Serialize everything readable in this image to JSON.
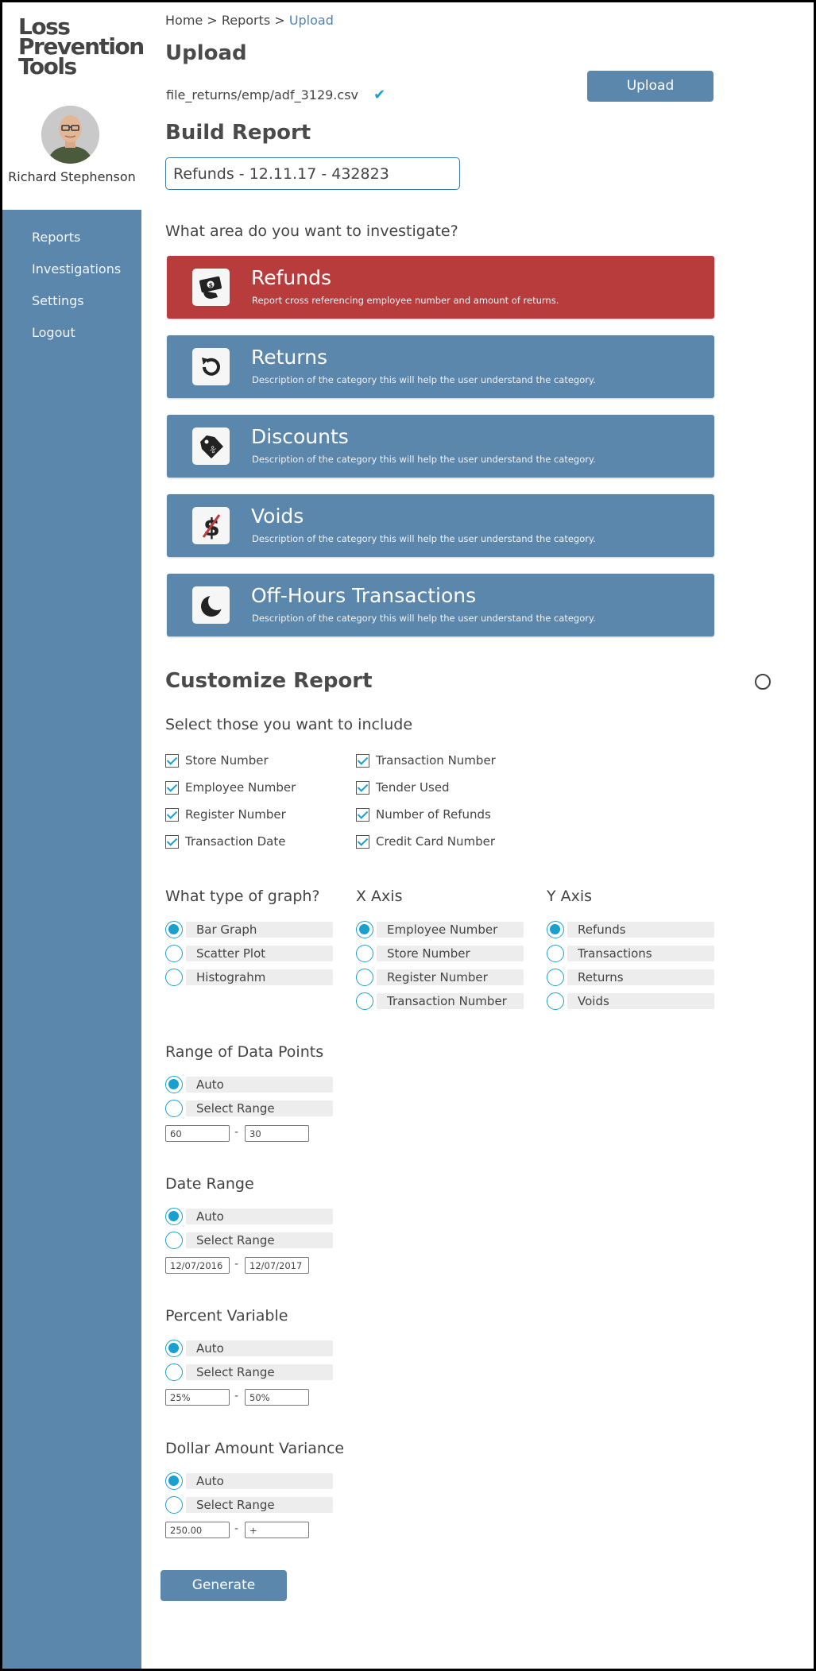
{
  "brand": {
    "logo_lines": [
      "Loss",
      "Prevention",
      "Tools"
    ]
  },
  "user": {
    "name": "Richard Stephenson"
  },
  "nav": {
    "items": [
      "Reports",
      "Investigations",
      "Settings",
      "Logout"
    ]
  },
  "breadcrumb": {
    "items": [
      "Home",
      "Reports"
    ],
    "separator": ">",
    "current": "Upload"
  },
  "upload": {
    "title": "Upload",
    "file_path": "file_returns/emp/adf_3129.csv",
    "button_label": "Upload"
  },
  "build": {
    "title": "Build Report",
    "report_name": "Refunds - 12.11.17 - 432823",
    "question": "What area do you want to investigate?"
  },
  "categories": [
    {
      "name": "Refunds",
      "description": "Report cross referencing employee number and amount of returns.",
      "icon": "money-icon",
      "selected": true
    },
    {
      "name": "Returns",
      "description": "Description of the category this will help the user understand the category.",
      "icon": "return-arrow-icon",
      "selected": false
    },
    {
      "name": "Discounts",
      "description": "Description of the category this will help the user understand the category.",
      "icon": "price-tag-icon",
      "selected": false
    },
    {
      "name": "Voids",
      "description": "Description of the category this will help the user understand the category.",
      "icon": "void-dollar-icon",
      "selected": false
    },
    {
      "name": "Off-Hours Transactions",
      "description": "Description of the category this will help the user understand the category.",
      "icon": "moon-icon",
      "selected": false
    }
  ],
  "customize": {
    "title": "Customize Report",
    "include_prompt": "Select those you want to include",
    "include_left": [
      "Store Number",
      "Employee Number",
      "Register Number",
      "Transaction Date"
    ],
    "include_right": [
      "Transaction Number",
      "Tender Used",
      "Number of Refunds",
      "Credit Card Number"
    ]
  },
  "graph": {
    "type_label": "What type of graph?",
    "types": [
      "Bar Graph",
      "Scatter Plot",
      "Histograhm"
    ],
    "selected_type": "Bar Graph",
    "x_label": "X Axis",
    "x_options": [
      "Employee Number",
      "Store Number",
      "Register Number",
      "Transaction Number"
    ],
    "selected_x": "Employee Number",
    "y_label": "Y Axis",
    "y_options": [
      "Refunds",
      "Transactions",
      "Returns",
      "Voids"
    ],
    "selected_y": "Refunds"
  },
  "ranges": [
    {
      "title": "Range of Data Points",
      "options": [
        "Auto",
        "Select Range"
      ],
      "from": "60",
      "to": "30"
    },
    {
      "title": "Date Range",
      "options": [
        "Auto",
        "Select Range"
      ],
      "from": "12/07/2016",
      "to": "12/07/2017"
    },
    {
      "title": "Percent Variable",
      "options": [
        "Auto",
        "Select Range"
      ],
      "from": "25%",
      "to": "50%"
    },
    {
      "title": "Dollar Amount Variance",
      "options": [
        "Auto",
        "Select Range"
      ],
      "from": "250.00",
      "to": "+"
    }
  ],
  "range_dash": "-",
  "generate_label": "Generate",
  "colors": {
    "nav_blue": "#5b87ad",
    "selected_red": "#b83c3c",
    "accent": "#1aa0d0"
  }
}
